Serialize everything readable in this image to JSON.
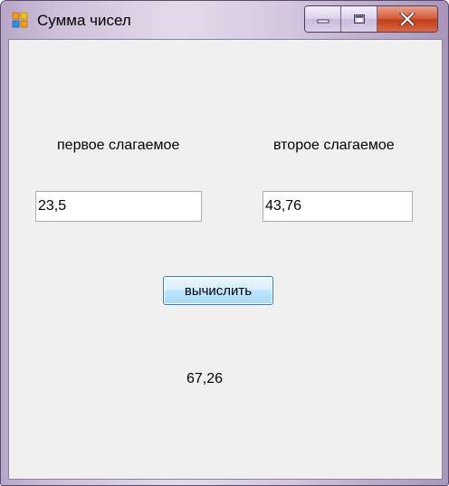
{
  "window": {
    "title": "Сумма чисел",
    "icon": "windows-form-icon"
  },
  "controls": {
    "minimize_icon": "minimize-icon",
    "maximize_icon": "maximize-icon",
    "close_icon": "close-icon",
    "close_color": "#c7411e"
  },
  "form": {
    "label1": "первое слагаемое",
    "label2": "второе слагаемое",
    "input1_value": "23,5",
    "input2_value": "43,76",
    "button_label": "вычислить",
    "result": "67,26"
  }
}
